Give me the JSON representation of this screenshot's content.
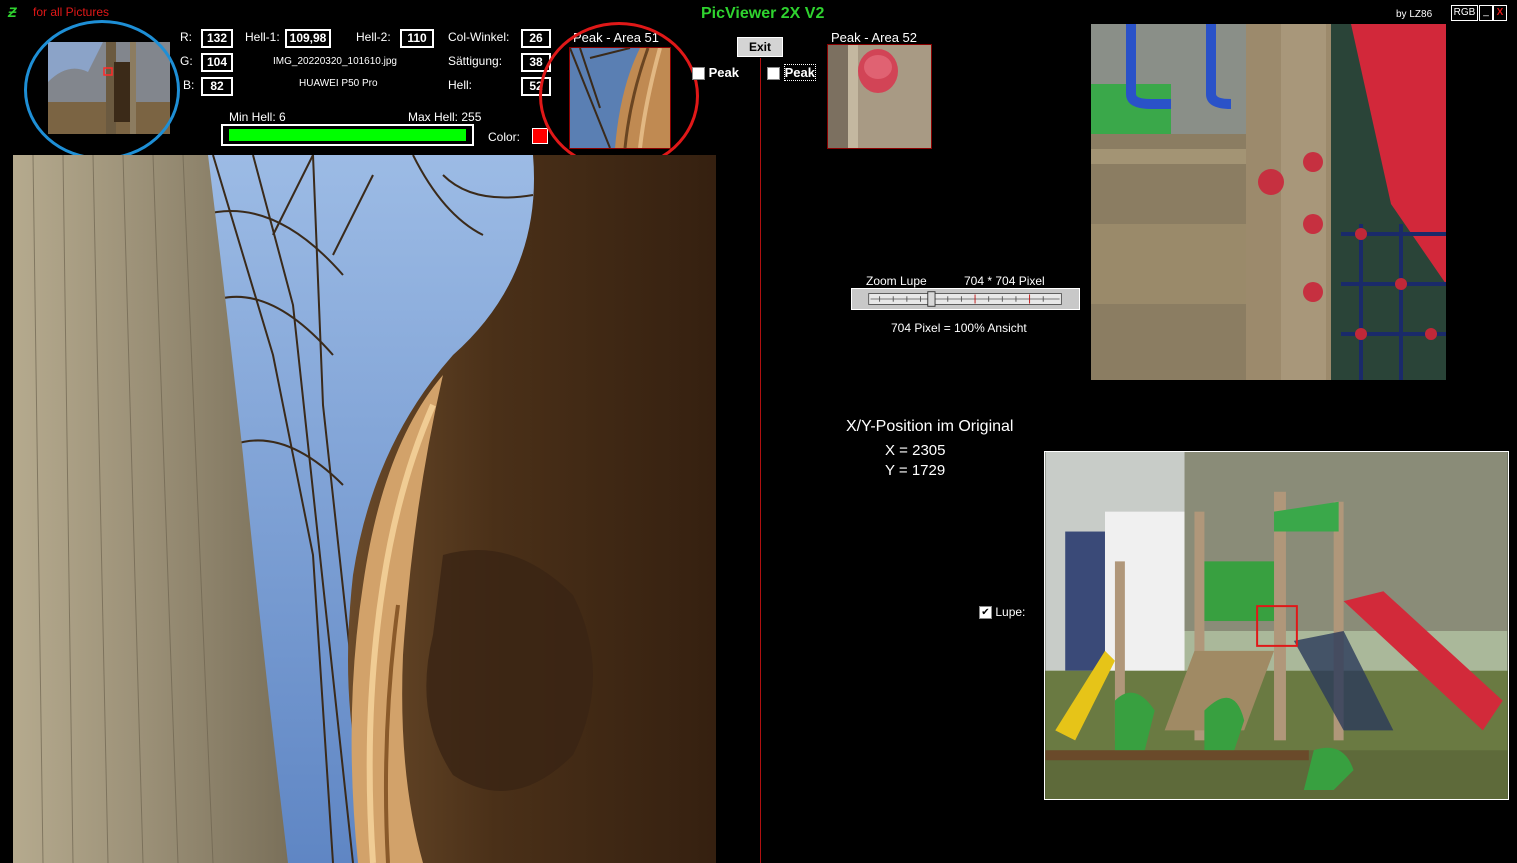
{
  "app": {
    "title": "PicViewer 2X V2",
    "logo_glyph": "Ƶ",
    "for_all_label": "for all Pictures",
    "by_label": "by LZ86",
    "rgb_button": "RGB",
    "minimize_button": "_",
    "close_button": "X",
    "exit_button": "Exit"
  },
  "rgb": {
    "r_label": "R:",
    "r_value": "132",
    "g_label": "G:",
    "g_value": "104",
    "b_label": "B:",
    "b_value": "82"
  },
  "hell": {
    "hell1_label": "Hell-1:",
    "hell1_value": "109,98",
    "hell2_label": "Hell-2:",
    "hell2_value": "110",
    "min_label": "Min Hell:",
    "min_value": "6",
    "max_label": "Max Hell:",
    "max_value": "255",
    "bar_fill_fraction": 1.0,
    "bar_color": "#00ff00"
  },
  "file": {
    "name": "IMG_20220320_101610.jpg",
    "camera": "HUAWEI P50 Pro"
  },
  "color_info": {
    "col_winkel_label": "Col-Winkel:",
    "col_winkel_value": "26",
    "saettigung_label": "Sättigung:",
    "saettigung_value": "38",
    "hell_label": "Hell:",
    "hell_value": "52",
    "color_label": "Color:",
    "color_swatch": "#ff0000"
  },
  "peak51": {
    "title": "Peak - Area 51",
    "checkbox_label": "Peak",
    "checked": false
  },
  "peak52": {
    "title": "Peak - Area 52",
    "checkbox_label": "Peak",
    "checked": false
  },
  "zoom": {
    "label": "Zoom Lupe",
    "pixels_label": "704 * 704 Pixel",
    "note": "704 Pixel = 100% Ansicht"
  },
  "position": {
    "heading": "X/Y-Position im Original",
    "x_label": "X =",
    "x_value": "2305",
    "y_label": "Y =",
    "y_value": "1729"
  },
  "lupe": {
    "label": "Lupe:",
    "checked": true
  },
  "colors": {
    "title_green": "#2fd32f",
    "highlight_blue": "#1e8fd6",
    "highlight_red": "#e01818",
    "divider_red": "#b01010"
  }
}
